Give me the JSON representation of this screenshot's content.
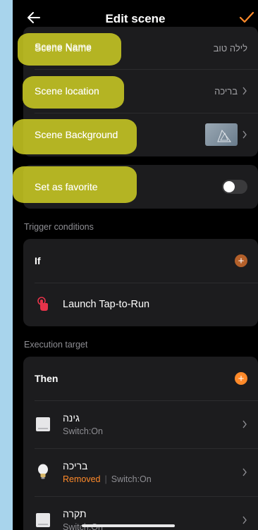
{
  "header": {
    "title": "Edit scene",
    "back_icon": "arrow-left-icon",
    "confirm_icon": "check-icon",
    "accent": "#ff8a2a"
  },
  "settings": {
    "scene_name_label": "Scene Name",
    "scene_name_value": "לילה טוב",
    "scene_location_label": "Scene location",
    "scene_location_value": "בריכה",
    "scene_background_label": "Scene Background",
    "favorite_label": "Set as favorite",
    "favorite_on": false
  },
  "trigger": {
    "section_label": "Trigger conditions",
    "if_label": "If",
    "launch_label": "Launch Tap-to-Run"
  },
  "execution": {
    "section_label": "Execution target",
    "then_label": "Then",
    "devices": [
      {
        "name": "גינה",
        "status": "Switch:On",
        "removed": ""
      },
      {
        "name": "בריכה",
        "status": "Switch:On",
        "removed": "Removed"
      },
      {
        "name": "תקרה",
        "status": "Switch:On",
        "removed": ""
      }
    ]
  },
  "colors": {
    "highlight": "#d6d624",
    "removed": "#ff8a2a",
    "card": "#1c1c1e"
  }
}
